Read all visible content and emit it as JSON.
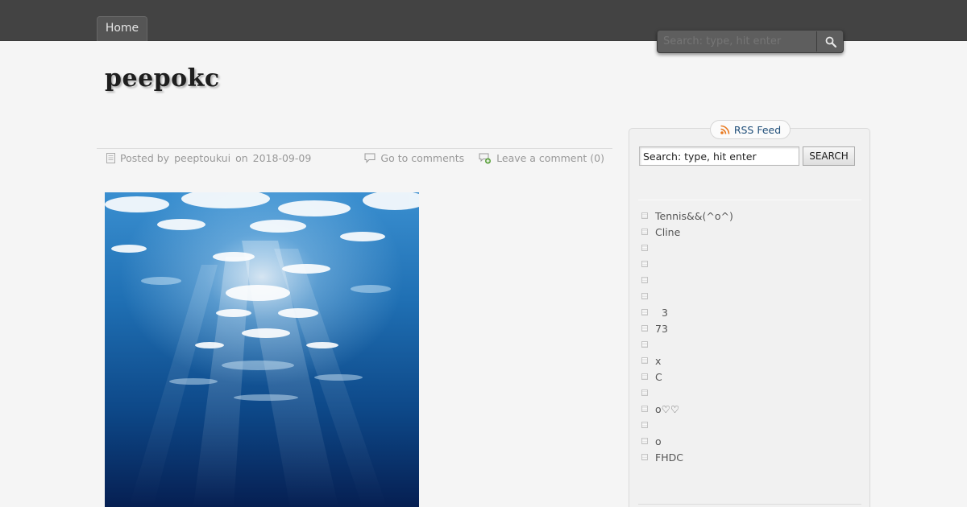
{
  "nav": {
    "home_label": "Home"
  },
  "top_search": {
    "placeholder": "Search: type, hit enter"
  },
  "site": {
    "title": "peepokc"
  },
  "post": {
    "meta_prefix": "Posted by",
    "author": "peeptoukui",
    "meta_on": "on",
    "date": "2018-09-09",
    "comments_link": "Go to comments",
    "leave_comment": "Leave a comment (0)",
    "image_icon": "underwater-photo"
  },
  "sidebar": {
    "rss_label": "RSS Feed",
    "search_value": "Search: type, hit enter",
    "search_button": "SEARCH",
    "items": [
      {
        "label": "Tennis&&(^o^)"
      },
      {
        "label": "Cline"
      },
      {
        "label": ""
      },
      {
        "label": ""
      },
      {
        "label": ""
      },
      {
        "label": ""
      },
      {
        "label": "  3"
      },
      {
        "label": "73"
      },
      {
        "label": ""
      },
      {
        "label": "x"
      },
      {
        "label": "C"
      },
      {
        "label": ""
      },
      {
        "label": "o♡♡"
      },
      {
        "label": ""
      },
      {
        "label": "o"
      },
      {
        "label": "FHDC"
      }
    ]
  },
  "colors": {
    "topbar": "#434343",
    "link": "#1f4e79",
    "background": "#f5f5f5"
  }
}
